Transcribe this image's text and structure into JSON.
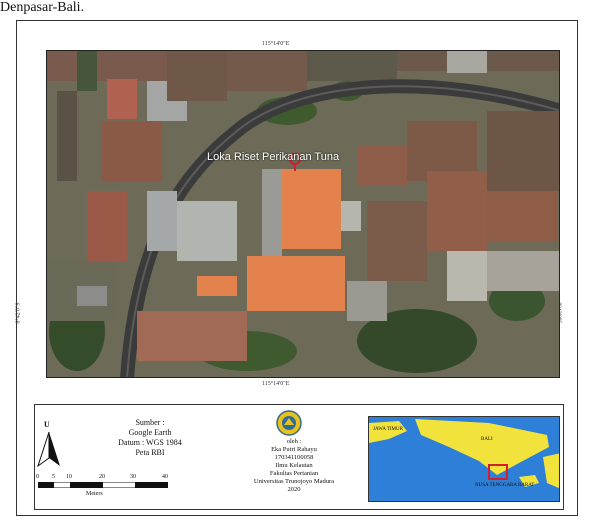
{
  "caption": "Denpasar-Bali.",
  "map": {
    "coord_top": "115°14'0\"E",
    "coord_bottom": "115°14'0\"E",
    "coord_left": "8°42'0\"S",
    "coord_right": "8°42'0\"S",
    "place_label": "Loka Riset Perikanan Tuna"
  },
  "legend": {
    "north_letter": "U",
    "sources": [
      "Sumber :",
      "Google Earth",
      "Datum : WGS 1984",
      "Peta RBI"
    ],
    "scale_ticks": [
      "0",
      "5",
      "10",
      "20",
      "30",
      "40"
    ],
    "scale_unit": "Meters",
    "author": [
      "oleh :",
      "Eka Putri Rahayu",
      "170341100058",
      "Ilmu Kelautan",
      "Fakultas Pertanian",
      "Universitas Trunojoyo Madura",
      "2020"
    ],
    "inset_labels": [
      "JAWA TIMUR",
      "BALI",
      "NUSA TENGGARA BARAT"
    ]
  },
  "colors": {
    "roof_orange": "#e4824e",
    "road": "#3b3b3b",
    "vegetation": "#3f5a2e",
    "sea": "#2e7fd8",
    "land": "#f2e23c",
    "marker": "#d11f2b"
  }
}
